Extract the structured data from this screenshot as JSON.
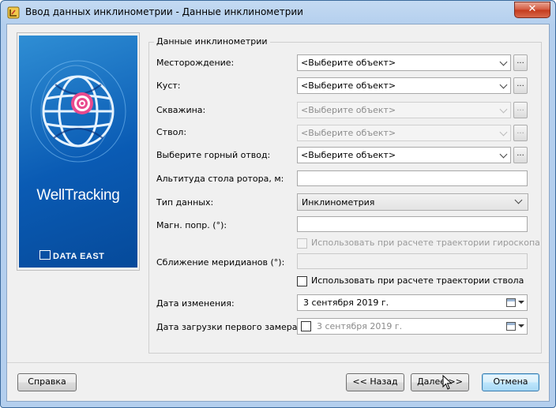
{
  "window": {
    "title": "Ввод данных инклинометрии - Данные инклинометрии",
    "close_label": "✕"
  },
  "branding": {
    "product_name": "WellTracking",
    "company": "DATA EAST"
  },
  "group": {
    "title": "Данные инклинометрии"
  },
  "fields": {
    "field_label": "Месторождение:",
    "field_value": "<Выберите объект>",
    "pad_label": "Куст:",
    "pad_value": "<Выберите объект>",
    "well_label": "Скважина:",
    "well_value": "<Выберите объект>",
    "bore_label": "Ствол:",
    "bore_value": "<Выберите объект>",
    "allotment_label": "Выберите горный отвод:",
    "allotment_value": "<Выберите объект>",
    "browse_label": "...",
    "rotor_alt_label": "Альтитуда стола ротора, м:",
    "rotor_alt_value": "",
    "data_type_label": "Тип данных:",
    "data_type_value": "Инклинометрия",
    "mag_corr_label": "Магн. попр. (°):",
    "mag_corr_value": "",
    "gyro_checkbox_label": "Использовать при расчете траектории гироскопа",
    "gyro_checked": false,
    "convergence_label": "Сближение меридианов (°):",
    "convergence_value": "",
    "bore_checkbox_label": "Использовать при расчете траектории ствола",
    "bore_checked": false,
    "change_date_label": "Дата изменения:",
    "change_date_value": "3 сентября 2019 г.",
    "first_measure_label": "Дата загрузки первого замера:",
    "first_measure_value": "3 сентября 2019 г.",
    "first_measure_checked": false
  },
  "buttons": {
    "help": "Справка",
    "back": "<< Назад",
    "next": "Далее >>",
    "cancel": "Отмена"
  },
  "colors": {
    "title_bar": "#b4cfee",
    "close_button": "#c33a1d",
    "logo_background": "#0a5bb4",
    "default_button_border": "#3c7fb1"
  }
}
